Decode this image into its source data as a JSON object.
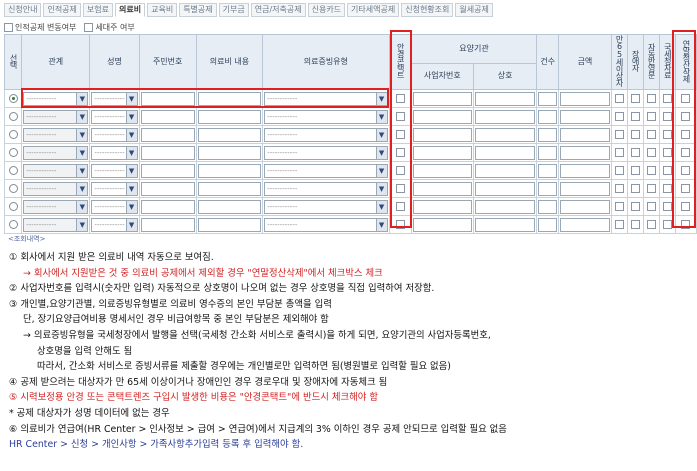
{
  "tabs": [
    "신청안내",
    "인적공제",
    "보험료",
    "의료비",
    "교육비",
    "특별공제",
    "기부금",
    "연금/저축공제",
    "신용카드",
    "기타세액공제",
    "신청현황조회",
    "월세공제"
  ],
  "active_tab_index": 3,
  "options": [
    "인적공제 변동여부",
    "세대주 여부"
  ],
  "table": {
    "headers": {
      "select": "선택",
      "relation": "관계",
      "name": "성명",
      "rrn": "주민번호",
      "med_content": "의료비 내용",
      "med_type": "의료증빙유형",
      "lens": "안경콘택트",
      "provider": "요양기관",
      "biz_no": "사업자번호",
      "company": "상호",
      "count": "건수",
      "amount": "금액",
      "senior": "만65세이상자",
      "disabled": "장애자",
      "auto_disabled": "자동반영분",
      "nts": "국세청자료",
      "year_end_delete": "연말정산삭제"
    },
    "placeholder_select": "------------",
    "rows": [
      {
        "selected": true
      },
      {
        "selected": false
      },
      {
        "selected": false
      },
      {
        "selected": false
      },
      {
        "selected": false
      },
      {
        "selected": false
      },
      {
        "selected": false
      },
      {
        "selected": false
      }
    ]
  },
  "caption": "<조회내역>",
  "notes": [
    {
      "text": "① 회사에서 지원 받은 의료비 내역 자동으로 보여짐.",
      "color": "black"
    },
    {
      "text": "→ 회사에서 지원받은 것 중 의료비 공제에서 제외할 경우 \"연말정산삭제\"에서 체크박스 체크",
      "color": "red",
      "indent": true
    },
    {
      "text": "② 사업자번호를 입력시(숫자만 입력) 자동적으로 상호명이 나오며 없는 경우 상호명을 직접 입력하여 저장함.",
      "color": "black"
    },
    {
      "text": "③ 개인별,요양기관별, 의료증빙유형별로 의료비 영수증의 본인 부담분 총액을 입력",
      "color": "black"
    },
    {
      "text": "단, 장기요양급여비용 명세서인 경우 비급여항목 중 본인 부담분은 제외해야 함",
      "color": "black",
      "indent": true
    },
    {
      "text": "→ 의료증빙유형을 국세청장에서 발행을 선택(국세청 간소화 서비스로 출력시)을 하게 되면, 요양기관의 사업자등록번호,",
      "color": "black",
      "indent": true
    },
    {
      "text": "상호명을 입력 안해도 됨",
      "color": "black",
      "indent2": true
    },
    {
      "text": "따라서, 간소화 서비스로 증빙서류를 제출할 경우에는 개인별로만 입력하면 됨(병원별로 입력할 필요 없음)",
      "color": "black",
      "indent2": true
    },
    {
      "text": "④ 공제 받으려는 대상자가 만 65세 이상이거나 장애인인 경우 경로우대 및 장애자에 자동체크 됨",
      "color": "black"
    },
    {
      "text": "⑤ 시력보정용 안경 또는 콘택트렌즈 구입시 발생한 비용은 \"안경콘택트\"에 반드시 체크해야 함",
      "color": "red"
    },
    {
      "text": "* 공제 대상자가 성명 데이터에 없는 경우",
      "color": "black"
    },
    {
      "text": "⑥ 의료비가 연급여(HR Center > 인사정보 > 급여 > 연급여)에서 지급계의 3% 이하인 경우 공제 안되므로 입력할 필요 없음",
      "color": "black"
    },
    {
      "text": "HR Center > 신청 > 개인사항 > 가족사항추가입력 등록 후 입력해야 함.",
      "color": "blue"
    }
  ],
  "colors": {
    "highlight": "#e02020",
    "header_bg": "#e6edf5",
    "red_text": "#d41f1f",
    "blue_text": "#2c3e9a"
  }
}
